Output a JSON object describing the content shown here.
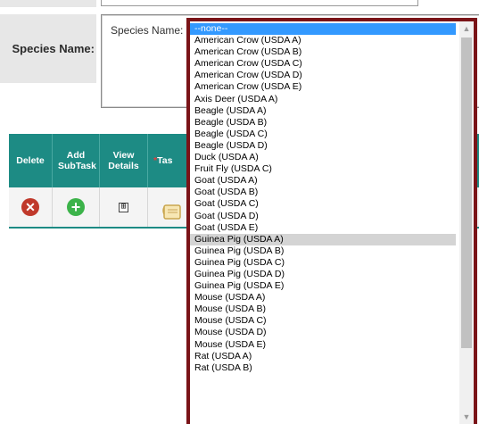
{
  "form": {
    "species_label": "Species Name:",
    "species_inner_label": "Species Name:"
  },
  "grid": {
    "headers": {
      "delete": "Delete",
      "add_subtask": "Add SubTask",
      "view_details": "View Details",
      "task": "Tas"
    },
    "required_marker": "*",
    "row": {
      "delete_icon": "x-circle-icon",
      "add_icon": "plus-circle-icon",
      "expand_glyph": "⊞",
      "note_icon": "notepad-icon"
    }
  },
  "dropdown": {
    "selected_index": 0,
    "hover_index": 18,
    "options": [
      "--none--",
      "American Crow (USDA A)",
      "American Crow (USDA B)",
      "American Crow (USDA C)",
      "American Crow (USDA D)",
      "American Crow (USDA E)",
      "Axis Deer (USDA A)",
      "Beagle (USDA A)",
      "Beagle (USDA B)",
      "Beagle (USDA C)",
      "Beagle (USDA D)",
      "Duck (USDA A)",
      "Fruit Fly (USDA C)",
      "Goat (USDA A)",
      "Goat (USDA B)",
      "Goat (USDA C)",
      "Goat (USDA D)",
      "Goat (USDA E)",
      "Guinea Pig (USDA A)",
      "Guinea Pig (USDA B)",
      "Guinea Pig (USDA C)",
      "Guinea Pig (USDA D)",
      "Guinea Pig (USDA E)",
      "Mouse (USDA A)",
      "Mouse (USDA B)",
      "Mouse (USDA C)",
      "Mouse (USDA D)",
      "Mouse (USDA E)",
      "Rat (USDA A)",
      "Rat (USDA B)"
    ],
    "scroll_up": "▲",
    "scroll_down": "▼"
  },
  "colors": {
    "grid_header": "#1d8b84",
    "dropdown_border": "#7a1418",
    "selected_option": "#3399ff",
    "hover_option": "#d4d4d4"
  }
}
